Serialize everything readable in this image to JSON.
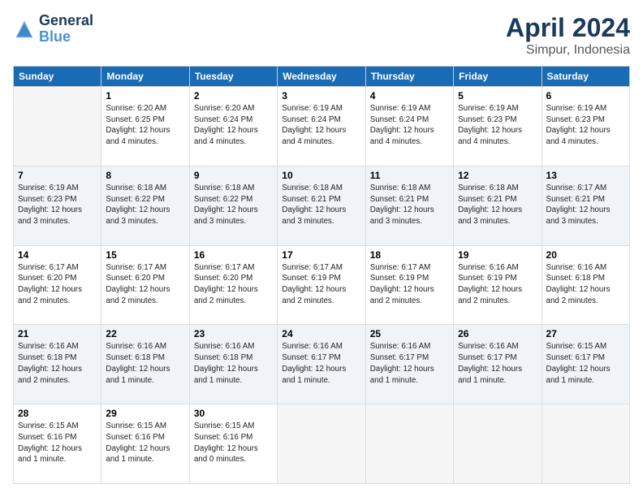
{
  "logo": {
    "line1": "General",
    "line2": "Blue"
  },
  "title": "April 2024",
  "location": "Simpur, Indonesia",
  "days_header": [
    "Sunday",
    "Monday",
    "Tuesday",
    "Wednesday",
    "Thursday",
    "Friday",
    "Saturday"
  ],
  "weeks": [
    {
      "alt": false,
      "days": [
        {
          "num": "",
          "info": "",
          "empty": true
        },
        {
          "num": "1",
          "info": "Sunrise: 6:20 AM\nSunset: 6:25 PM\nDaylight: 12 hours\nand 4 minutes."
        },
        {
          "num": "2",
          "info": "Sunrise: 6:20 AM\nSunset: 6:24 PM\nDaylight: 12 hours\nand 4 minutes."
        },
        {
          "num": "3",
          "info": "Sunrise: 6:19 AM\nSunset: 6:24 PM\nDaylight: 12 hours\nand 4 minutes."
        },
        {
          "num": "4",
          "info": "Sunrise: 6:19 AM\nSunset: 6:24 PM\nDaylight: 12 hours\nand 4 minutes."
        },
        {
          "num": "5",
          "info": "Sunrise: 6:19 AM\nSunset: 6:23 PM\nDaylight: 12 hours\nand 4 minutes."
        },
        {
          "num": "6",
          "info": "Sunrise: 6:19 AM\nSunset: 6:23 PM\nDaylight: 12 hours\nand 4 minutes."
        }
      ]
    },
    {
      "alt": true,
      "days": [
        {
          "num": "7",
          "info": "Sunrise: 6:19 AM\nSunset: 6:23 PM\nDaylight: 12 hours\nand 3 minutes."
        },
        {
          "num": "8",
          "info": "Sunrise: 6:18 AM\nSunset: 6:22 PM\nDaylight: 12 hours\nand 3 minutes."
        },
        {
          "num": "9",
          "info": "Sunrise: 6:18 AM\nSunset: 6:22 PM\nDaylight: 12 hours\nand 3 minutes."
        },
        {
          "num": "10",
          "info": "Sunrise: 6:18 AM\nSunset: 6:21 PM\nDaylight: 12 hours\nand 3 minutes."
        },
        {
          "num": "11",
          "info": "Sunrise: 6:18 AM\nSunset: 6:21 PM\nDaylight: 12 hours\nand 3 minutes."
        },
        {
          "num": "12",
          "info": "Sunrise: 6:18 AM\nSunset: 6:21 PM\nDaylight: 12 hours\nand 3 minutes."
        },
        {
          "num": "13",
          "info": "Sunrise: 6:17 AM\nSunset: 6:21 PM\nDaylight: 12 hours\nand 3 minutes."
        }
      ]
    },
    {
      "alt": false,
      "days": [
        {
          "num": "14",
          "info": "Sunrise: 6:17 AM\nSunset: 6:20 PM\nDaylight: 12 hours\nand 2 minutes."
        },
        {
          "num": "15",
          "info": "Sunrise: 6:17 AM\nSunset: 6:20 PM\nDaylight: 12 hours\nand 2 minutes."
        },
        {
          "num": "16",
          "info": "Sunrise: 6:17 AM\nSunset: 6:20 PM\nDaylight: 12 hours\nand 2 minutes."
        },
        {
          "num": "17",
          "info": "Sunrise: 6:17 AM\nSunset: 6:19 PM\nDaylight: 12 hours\nand 2 minutes."
        },
        {
          "num": "18",
          "info": "Sunrise: 6:17 AM\nSunset: 6:19 PM\nDaylight: 12 hours\nand 2 minutes."
        },
        {
          "num": "19",
          "info": "Sunrise: 6:16 AM\nSunset: 6:19 PM\nDaylight: 12 hours\nand 2 minutes."
        },
        {
          "num": "20",
          "info": "Sunrise: 6:16 AM\nSunset: 6:18 PM\nDaylight: 12 hours\nand 2 minutes."
        }
      ]
    },
    {
      "alt": true,
      "days": [
        {
          "num": "21",
          "info": "Sunrise: 6:16 AM\nSunset: 6:18 PM\nDaylight: 12 hours\nand 2 minutes."
        },
        {
          "num": "22",
          "info": "Sunrise: 6:16 AM\nSunset: 6:18 PM\nDaylight: 12 hours\nand 1 minute."
        },
        {
          "num": "23",
          "info": "Sunrise: 6:16 AM\nSunset: 6:18 PM\nDaylight: 12 hours\nand 1 minute."
        },
        {
          "num": "24",
          "info": "Sunrise: 6:16 AM\nSunset: 6:17 PM\nDaylight: 12 hours\nand 1 minute."
        },
        {
          "num": "25",
          "info": "Sunrise: 6:16 AM\nSunset: 6:17 PM\nDaylight: 12 hours\nand 1 minute."
        },
        {
          "num": "26",
          "info": "Sunrise: 6:16 AM\nSunset: 6:17 PM\nDaylight: 12 hours\nand 1 minute."
        },
        {
          "num": "27",
          "info": "Sunrise: 6:15 AM\nSunset: 6:17 PM\nDaylight: 12 hours\nand 1 minute."
        }
      ]
    },
    {
      "alt": false,
      "days": [
        {
          "num": "28",
          "info": "Sunrise: 6:15 AM\nSunset: 6:16 PM\nDaylight: 12 hours\nand 1 minute."
        },
        {
          "num": "29",
          "info": "Sunrise: 6:15 AM\nSunset: 6:16 PM\nDaylight: 12 hours\nand 1 minute."
        },
        {
          "num": "30",
          "info": "Sunrise: 6:15 AM\nSunset: 6:16 PM\nDaylight: 12 hours\nand 0 minutes."
        },
        {
          "num": "",
          "info": "",
          "empty": true
        },
        {
          "num": "",
          "info": "",
          "empty": true
        },
        {
          "num": "",
          "info": "",
          "empty": true
        },
        {
          "num": "",
          "info": "",
          "empty": true
        }
      ]
    }
  ]
}
